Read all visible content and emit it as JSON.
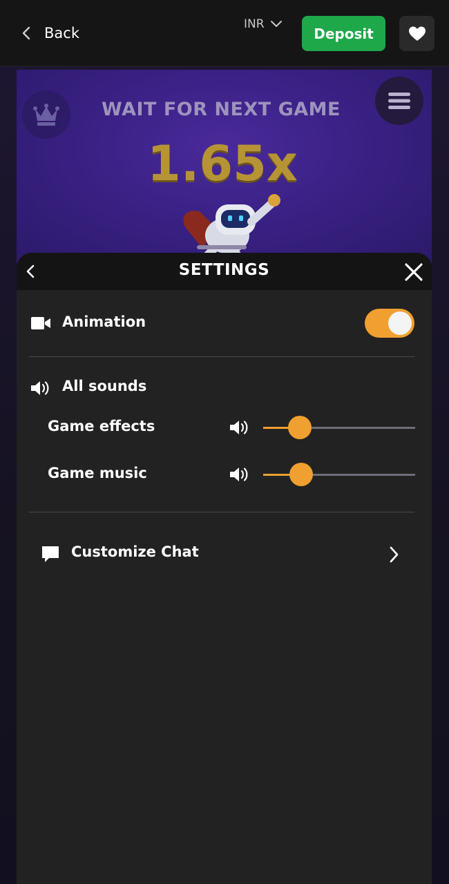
{
  "topbar": {
    "back_label": "Back",
    "currency": "INR",
    "deposit_label": "Deposit"
  },
  "game": {
    "status_text": "WAIT FOR NEXT GAME",
    "multiplier": "1.65x"
  },
  "settings": {
    "title": "SETTINGS",
    "animation": {
      "label": "Animation",
      "enabled": true
    },
    "sounds": {
      "label": "All sounds",
      "effects": {
        "label": "Game effects",
        "level": 0.24
      },
      "music": {
        "label": "Game music",
        "level": 0.25
      }
    },
    "chat": {
      "label": "Customize Chat"
    }
  },
  "colors": {
    "accent": "#f0a030",
    "deposit": "#1fa84a",
    "sheet_bg": "#222222"
  },
  "icons": {
    "back": "chevron-left-icon",
    "currency_dropdown": "chevron-down-icon",
    "favorite": "heart-icon",
    "crown": "crown-icon",
    "menu": "hamburger-icon",
    "animation": "video-camera-icon",
    "sound": "speaker-icon",
    "chat": "chat-bubble-icon",
    "close": "close-icon",
    "chat_arrow": "chevron-right-icon"
  }
}
